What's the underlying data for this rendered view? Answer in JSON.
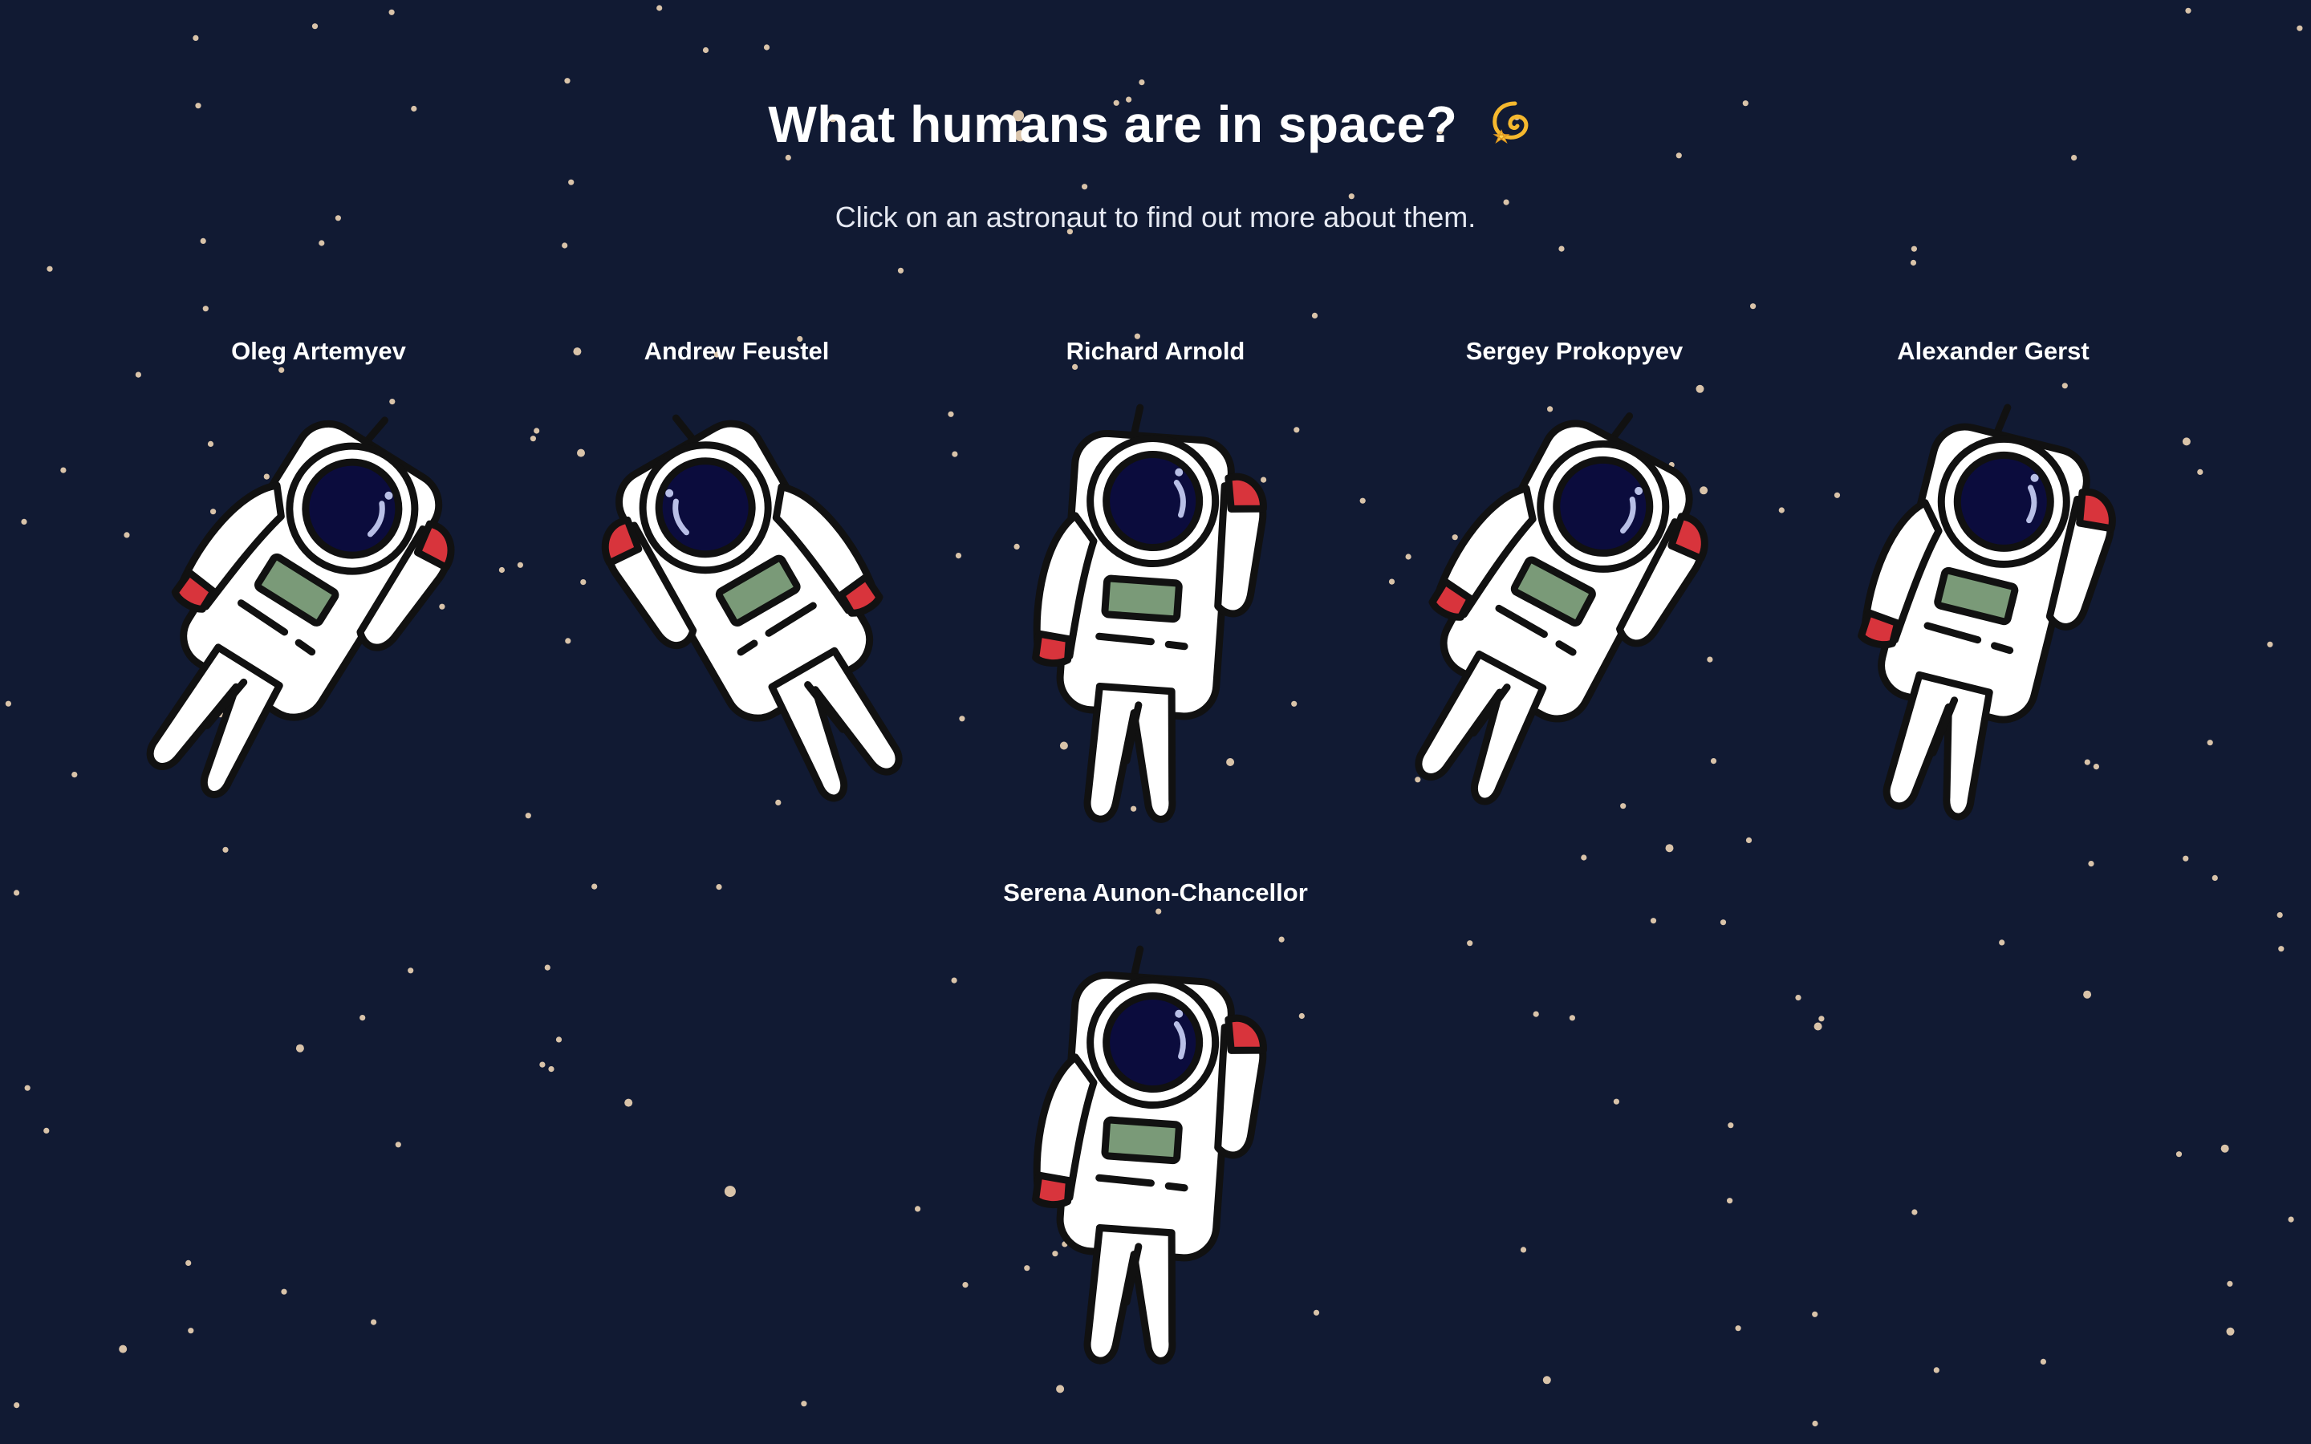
{
  "header": {
    "title": "What humans are in space?",
    "title_emoji_icon": "dizzy-comet-icon",
    "subtitle": "Click on an astronaut to find out more about them."
  },
  "colors": {
    "background": "#111a33",
    "star": "#d9c3a9",
    "suit": "#ffffff",
    "visor": "#0b0c3d",
    "chest_panel": "#7a9a78",
    "glove_accent": "#d8343c",
    "outline": "#111111"
  },
  "astronauts": [
    {
      "name": "Oleg Artemyev",
      "icon": "astronaut-icon"
    },
    {
      "name": "Andrew Feustel",
      "icon": "astronaut-icon"
    },
    {
      "name": "Richard Arnold",
      "icon": "astronaut-icon"
    },
    {
      "name": "Sergey Prokopyev",
      "icon": "astronaut-icon"
    },
    {
      "name": "Alexander Gerst",
      "icon": "astronaut-icon"
    },
    {
      "name": "Serena Aunon-Chancellor",
      "icon": "astronaut-icon"
    }
  ]
}
